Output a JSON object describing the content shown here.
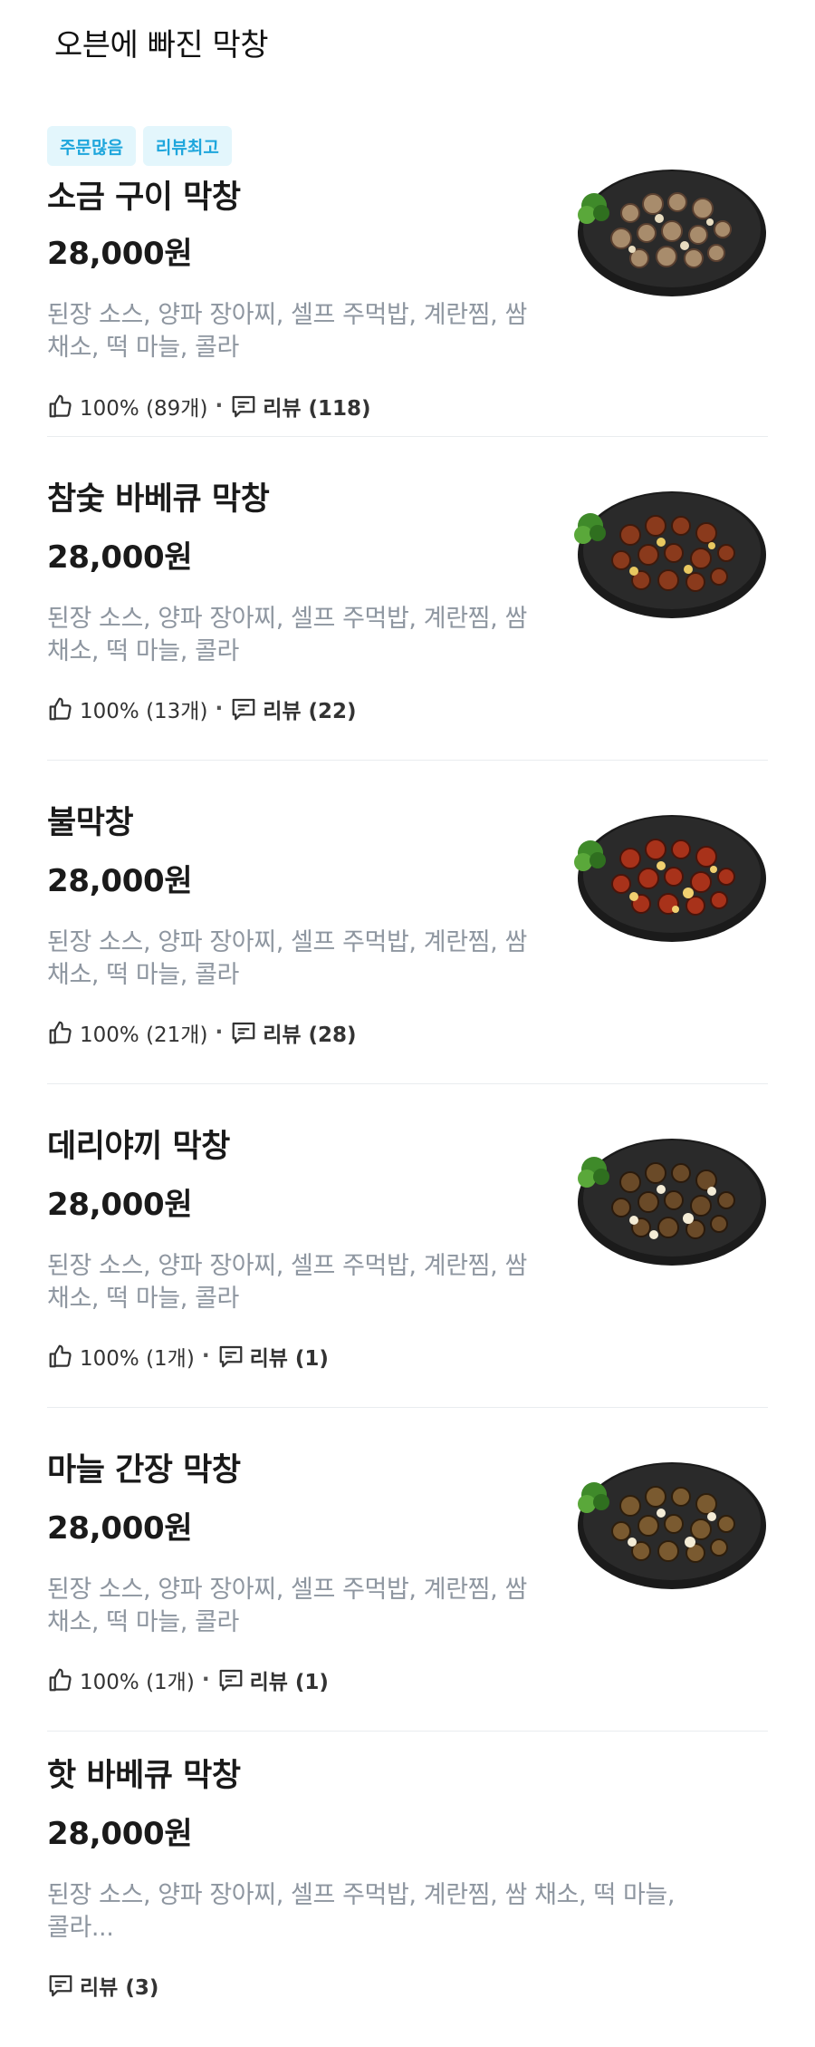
{
  "header": {
    "title": "오븐에 빠진 막창"
  },
  "menu": {
    "items": [
      {
        "badges": [
          "주문많음",
          "리뷰최고"
        ],
        "name": "소금 구이 막창",
        "price": "28,000원",
        "description": "된장 소스, 양파 장아찌, 셀프 주먹밥, 계란찜, 쌈 채소, 떡 마늘, 콜라",
        "likes": "100% (89개)",
        "reviews": "리뷰 (118)",
        "dish_style": "salt"
      },
      {
        "name": "참숯 바베큐 막창",
        "price": "28,000원",
        "description": "된장 소스, 양파 장아찌, 셀프 주먹밥, 계란찜, 쌈 채소, 떡 마늘, 콜라",
        "likes": "100% (13개)",
        "reviews": "리뷰 (22)",
        "dish_style": "bbq"
      },
      {
        "name": "불막창",
        "price": "28,000원",
        "description": "된장 소스, 양파 장아찌, 셀프 주먹밥, 계란찜, 쌈 채소, 떡 마늘, 콜라",
        "likes": "100% (21개)",
        "reviews": "리뷰 (28)",
        "dish_style": "fire"
      },
      {
        "name": "데리야끼 막창",
        "price": "28,000원",
        "description": "된장 소스, 양파 장아찌, 셀프 주먹밥, 계란찜, 쌈 채소, 떡 마늘, 콜라",
        "likes": "100% (1개)",
        "reviews": "리뷰 (1)",
        "dish_style": "teriyaki"
      },
      {
        "name": "마늘 간장 막창",
        "price": "28,000원",
        "description": "된장 소스, 양파 장아찌, 셀프 주먹밥, 계란찜, 쌈 채소, 떡 마늘, 콜라",
        "likes": "100% (1개)",
        "reviews": "리뷰 (1)",
        "dish_style": "garlic"
      },
      {
        "name": "핫 바베큐 막창",
        "price": "28,000원",
        "description": "된장 소스, 양파 장아찌, 셀프 주먹밥, 계란찜, 쌈 채소, 떡 마늘, 콜라...",
        "reviews": "리뷰 (3)"
      }
    ]
  },
  "colors": {
    "badge_bg": "#e3f6fc",
    "badge_text": "#1ea6dc",
    "description": "#8e96a0",
    "divider": "#e9ecef"
  },
  "icons": {
    "like": "thumbs-up-icon",
    "review": "speech-bubble-icon"
  }
}
